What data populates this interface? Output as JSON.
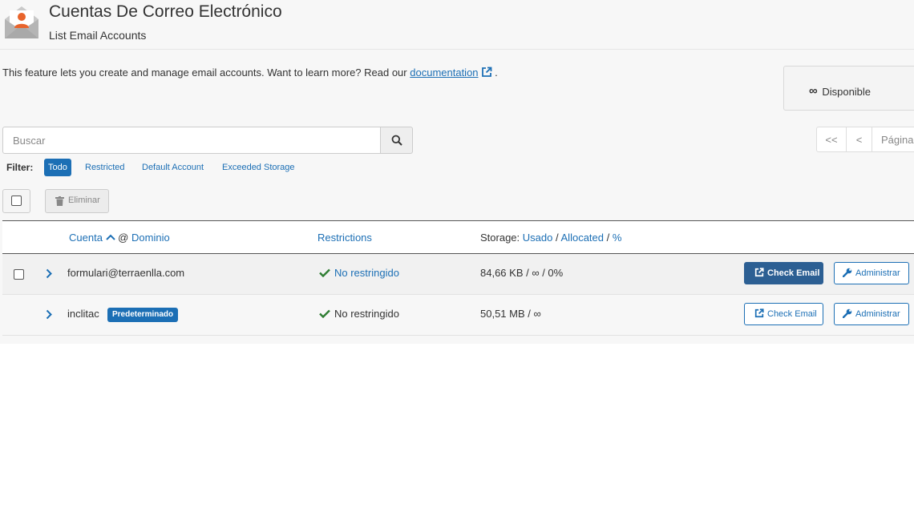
{
  "header": {
    "title": "Cuentas De Correo Electrónico",
    "subtitle": "List Email Accounts"
  },
  "intro": {
    "text": "This feature lets you create and manage email accounts. Want to learn more? Read our",
    "link_label": "documentation",
    "after": "."
  },
  "availability": {
    "symbol": "∞",
    "label": "Disponible"
  },
  "search": {
    "placeholder": "Buscar"
  },
  "pagination": {
    "first": "<<",
    "prev": "<",
    "page_label": "Página"
  },
  "filter": {
    "label": "Filter:",
    "options": [
      "Todo",
      "Restricted",
      "Default Account",
      "Exceeded Storage"
    ],
    "active": "Todo"
  },
  "toolbar": {
    "delete_label": "Eliminar"
  },
  "table": {
    "headers": {
      "account": "Cuenta",
      "at": "@",
      "domain": "Dominio",
      "restrictions": "Restrictions",
      "storage_prefix": "Storage:",
      "used": "Usado",
      "sep1": "/",
      "allocated": "Allocated",
      "sep2": "/",
      "percent": "%"
    },
    "rows": [
      {
        "account": "formulari@terraenlla.com",
        "badge": "",
        "restriction": "No restringido",
        "storage": "84,66 KB / ∞ / 0%",
        "check_label": "Check Email",
        "admin_label": "Administrar"
      },
      {
        "account": "inclitac",
        "badge": "Predeterminado",
        "restriction": "No restringido",
        "storage": "50,51 MB / ∞",
        "check_label": "Check Email",
        "admin_label": "Administrar"
      }
    ]
  },
  "colors": {
    "link": "#1c6fb5",
    "primary_button": "#2c5f93",
    "check_green": "#2e7d32",
    "logo_orange": "#e8642c"
  }
}
